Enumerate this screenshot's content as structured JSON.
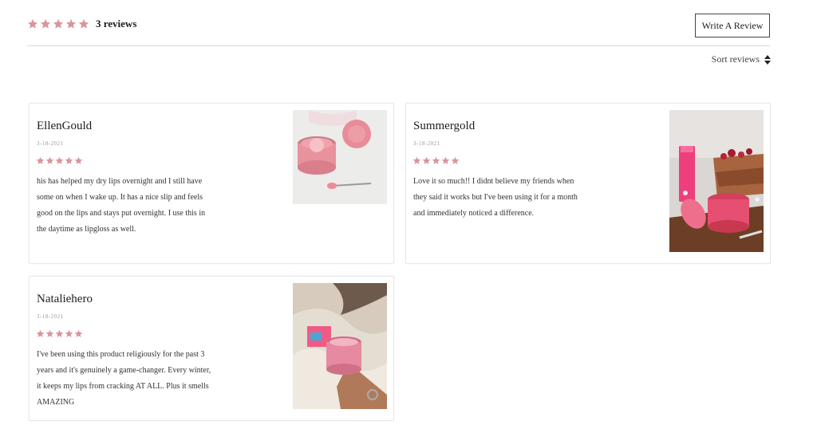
{
  "summary": {
    "rating_stars": 5,
    "count_label": "3 reviews"
  },
  "actions": {
    "write_review_label": "Write A Review",
    "sort_label": "Sort reviews"
  },
  "colors": {
    "star": "#d9969b",
    "border": "#e8e8e8"
  },
  "reviews": [
    {
      "author": "EllenGould",
      "date": "3-18-2021",
      "stars": 5,
      "text": "his has helped my dry lips overnight and I still have some on when I wake up. It has a nice slip and feels good on the lips and stays put overnight. I use this in the daytime as lipgloss as well."
    },
    {
      "author": "Summergold",
      "date": "3-18-2021",
      "stars": 5,
      "text": "Love it so much!! I didnt believe my friends when they said it works but I've been using it for a month and immediately noticed a difference."
    },
    {
      "author": "Nataliehero",
      "date": "3-18-2021",
      "stars": 5,
      "text": "I've been using this product religiously for the past 3 years and it's genuinely a game-changer. Every winter, it keeps my lips from cracking AT ALL. Plus it smells AMAZING"
    }
  ]
}
